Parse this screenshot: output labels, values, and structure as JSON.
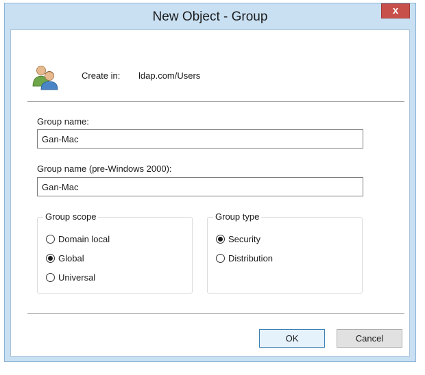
{
  "dialog": {
    "title": "New Object - Group",
    "close_label": "x"
  },
  "create_in": {
    "label": "Create in:",
    "value": "ldap.com/Users"
  },
  "group_name": {
    "label": "Group name:",
    "value": "Gan-Mac"
  },
  "group_name_pre2000": {
    "label": "Group name (pre-Windows 2000):",
    "value": "Gan-Mac"
  },
  "group_scope": {
    "legend": "Group scope",
    "options": [
      {
        "label": "Domain local",
        "selected": false
      },
      {
        "label": "Global",
        "selected": true
      },
      {
        "label": "Universal",
        "selected": false
      }
    ]
  },
  "group_type": {
    "legend": "Group type",
    "options": [
      {
        "label": "Security",
        "selected": true
      },
      {
        "label": "Distribution",
        "selected": false
      }
    ]
  },
  "buttons": {
    "ok": "OK",
    "cancel": "Cancel"
  },
  "colors": {
    "frame": "#c9e0f3",
    "close_button": "#c7504b",
    "default_button_border": "#3c7fb1"
  },
  "icons": {
    "header_icon": "group-users-icon"
  }
}
